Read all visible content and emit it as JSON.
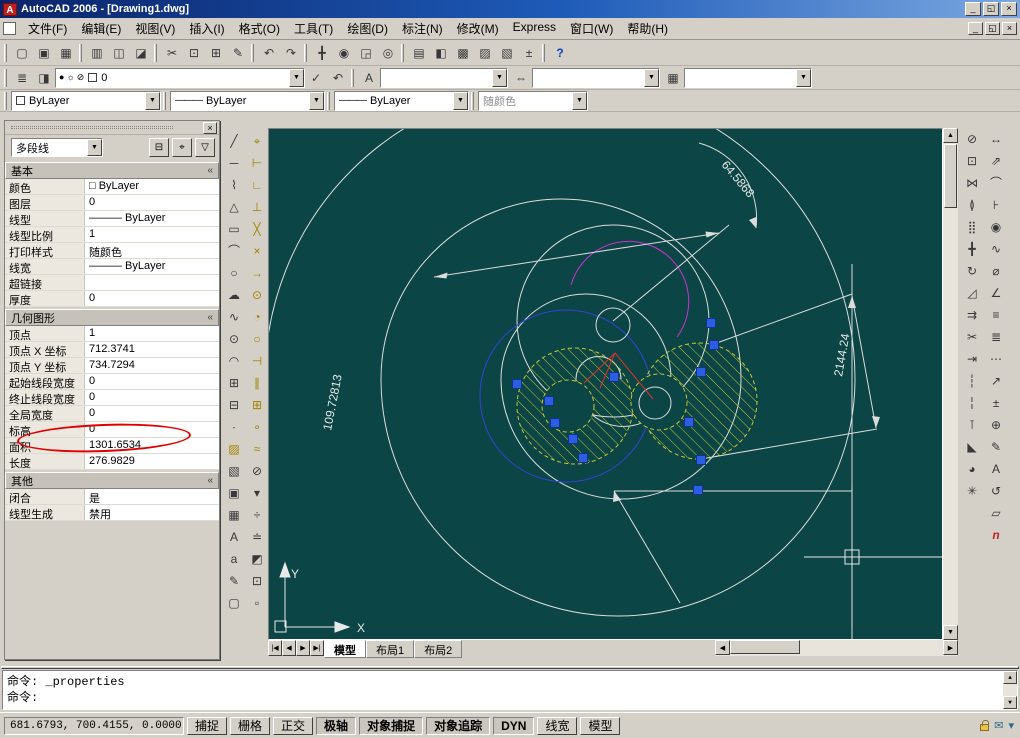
{
  "window": {
    "title": "AutoCAD 2006 - [Drawing1.dwg]",
    "app_icon": "A",
    "controls": [
      {
        "name": "minimize-button",
        "glyph": "_"
      },
      {
        "name": "restore-button",
        "glyph": "◱"
      },
      {
        "name": "close-button",
        "glyph": "×"
      }
    ]
  },
  "menu": {
    "items": [
      "文件(F)",
      "编辑(E)",
      "视图(V)",
      "插入(I)",
      "格式(O)",
      "工具(T)",
      "绘图(D)",
      "标注(N)",
      "修改(M)",
      "Express",
      "窗口(W)",
      "帮助(H)"
    ]
  },
  "scroll": {
    "up": "▲",
    "down": "▼",
    "left": "◀",
    "right": "▶"
  },
  "toolbar_main": {
    "file": [
      {
        "name": "new-file-icon",
        "glyph": "▢"
      },
      {
        "name": "open-file-icon",
        "glyph": "▣"
      },
      {
        "name": "save-icon",
        "glyph": "▦"
      }
    ],
    "print": [
      {
        "name": "plot-icon",
        "glyph": "▥"
      },
      {
        "name": "plot-preview-icon",
        "glyph": "◫"
      },
      {
        "name": "publish-icon",
        "glyph": "◪"
      }
    ],
    "clip": [
      {
        "name": "cut-icon",
        "glyph": "✂"
      },
      {
        "name": "copy-icon",
        "glyph": "⊡"
      },
      {
        "name": "paste-icon",
        "glyph": "⊞"
      },
      {
        "name": "match-properties-icon",
        "glyph": "✎"
      }
    ],
    "undo": [
      {
        "name": "undo-icon",
        "glyph": "↶"
      },
      {
        "name": "redo-icon",
        "glyph": "↷"
      }
    ],
    "zoom": [
      {
        "name": "pan-icon",
        "glyph": "╋"
      },
      {
        "name": "zoom-realtime-icon",
        "glyph": "◉"
      },
      {
        "name": "zoom-window-icon",
        "glyph": "◲"
      },
      {
        "name": "zoom-previous-icon",
        "glyph": "◎"
      }
    ],
    "palettes": [
      {
        "name": "properties-palette-icon",
        "glyph": "▤"
      },
      {
        "name": "designcenter-icon",
        "glyph": "◧"
      },
      {
        "name": "tool-palettes-icon",
        "glyph": "▩"
      },
      {
        "name": "sheet-set-manager-icon",
        "glyph": "▨"
      },
      {
        "name": "markup-set-manager-icon",
        "glyph": "▧"
      },
      {
        "name": "quickcalc-icon",
        "glyph": "±"
      }
    ],
    "help": [
      {
        "name": "help-icon",
        "glyph": "?",
        "cls": "blue"
      }
    ]
  },
  "layers_toolbar": {
    "icons_left": [
      {
        "name": "layer-properties-manager-icon",
        "glyph": "≣"
      },
      {
        "name": "layer-states-icon",
        "glyph": "◨"
      }
    ],
    "layer_dropdown": {
      "status_icons": [
        "●",
        "☼",
        "⊘"
      ],
      "value": "0"
    },
    "icons_right": [
      {
        "name": "make-object-layer-current-icon",
        "glyph": "✓"
      },
      {
        "name": "layer-previous-icon",
        "glyph": "↶"
      }
    ],
    "styles": [
      {
        "name": "text-style-control",
        "icon": "A",
        "value": ""
      },
      {
        "name": "dim-style-control",
        "icon": "⇔",
        "value": ""
      },
      {
        "name": "table-style-control",
        "icon": "▦",
        "value": ""
      }
    ]
  },
  "properties_toolbar": {
    "line_sample": "———",
    "color_value": "ByLayer",
    "linetype_value": "ByLayer",
    "lineweight_value": "ByLayer",
    "plotstyle_value": "随颜色"
  },
  "left_toolbars": {
    "draw": [
      {
        "name": "line-icon",
        "glyph": "╱"
      },
      {
        "name": "construction-line-icon",
        "glyph": "─"
      },
      {
        "name": "polyline-icon",
        "glyph": "⌇"
      },
      {
        "name": "polygon-icon",
        "glyph": "△"
      },
      {
        "name": "rectangle-icon",
        "glyph": "▭"
      },
      {
        "name": "arc-icon",
        "glyph": "⌒"
      },
      {
        "name": "circle-icon",
        "glyph": "○"
      },
      {
        "name": "revision-cloud-icon",
        "glyph": "☁"
      },
      {
        "name": "spline-icon",
        "glyph": "∿"
      },
      {
        "name": "ellipse-icon",
        "glyph": "⊙"
      },
      {
        "name": "ellipse-arc-icon",
        "glyph": "◠"
      },
      {
        "name": "insert-block-icon",
        "glyph": "⊞"
      },
      {
        "name": "make-block-icon",
        "glyph": "⊟"
      },
      {
        "name": "point-icon",
        "glyph": "∙"
      },
      {
        "name": "hatch-icon",
        "glyph": "▨",
        "cls": "yellow"
      },
      {
        "name": "gradient-icon",
        "glyph": "▧"
      },
      {
        "name": "region-icon",
        "glyph": "▣"
      },
      {
        "name": "table-icon",
        "glyph": "▦"
      },
      {
        "name": "multiline-text-icon",
        "glyph": "A"
      },
      {
        "name": "single-line-text-icon",
        "glyph": "a"
      },
      {
        "name": "edit-text-icon",
        "glyph": "✎"
      },
      {
        "name": "boundary-icon",
        "glyph": "▢"
      }
    ],
    "aux": [
      {
        "name": "temporary-track-point-icon",
        "glyph": "⌖",
        "cls": "yellow"
      },
      {
        "name": "snap-from-icon",
        "glyph": "⊢",
        "cls": "yellow"
      },
      {
        "name": "snap-endpoint-icon",
        "glyph": "∟",
        "cls": "yellow"
      },
      {
        "name": "snap-midpoint-icon",
        "glyph": "⊥",
        "cls": "yellow"
      },
      {
        "name": "snap-intersection-icon",
        "glyph": "╳",
        "cls": "yellow"
      },
      {
        "name": "snap-apparent-intersection-icon",
        "glyph": "×",
        "cls": "yellow"
      },
      {
        "name": "snap-extension-icon",
        "glyph": "→",
        "cls": "yellow"
      },
      {
        "name": "snap-center-icon",
        "glyph": "⊙",
        "cls": "yellow"
      },
      {
        "name": "snap-quadrant-icon",
        "glyph": "◔",
        "cls": "yellow"
      },
      {
        "name": "snap-tangent-icon",
        "glyph": "○",
        "cls": "yellow"
      },
      {
        "name": "snap-perpendicular-icon",
        "glyph": "⊣",
        "cls": "yellow"
      },
      {
        "name": "snap-parallel-icon",
        "glyph": "∥",
        "cls": "yellow"
      },
      {
        "name": "snap-insert-icon",
        "glyph": "⊞",
        "cls": "yellow"
      },
      {
        "name": "snap-node-icon",
        "glyph": "∘",
        "cls": "yellow"
      },
      {
        "name": "snap-nearest-icon",
        "glyph": "≈",
        "cls": "yellow"
      },
      {
        "name": "snap-none-icon",
        "glyph": "⊘"
      },
      {
        "name": "osnap-settings-icon",
        "glyph": "▾"
      },
      {
        "name": "divide-icon",
        "glyph": "÷"
      },
      {
        "name": "measure-icon",
        "glyph": "≐"
      },
      {
        "name": "block-editor-icon",
        "glyph": "◩"
      },
      {
        "name": "xref-icon",
        "glyph": "⊡"
      },
      {
        "name": "image-icon",
        "glyph": "▫"
      }
    ]
  },
  "right_toolbars": {
    "modify": [
      {
        "name": "erase-icon",
        "glyph": "⊘"
      },
      {
        "name": "copy-object-icon",
        "glyph": "⊡"
      },
      {
        "name": "mirror-icon",
        "glyph": "⋈"
      },
      {
        "name": "offset-icon",
        "glyph": "≬"
      },
      {
        "name": "array-icon",
        "glyph": "⣿"
      },
      {
        "name": "move-icon",
        "glyph": "╋"
      },
      {
        "name": "rotate-icon",
        "glyph": "↻"
      },
      {
        "name": "scale-icon",
        "glyph": "◿"
      },
      {
        "name": "stretch-icon",
        "glyph": "⇉"
      },
      {
        "name": "trim-icon",
        "glyph": "✂"
      },
      {
        "name": "extend-icon",
        "glyph": "⇥"
      },
      {
        "name": "break-at-point-icon",
        "glyph": "┆"
      },
      {
        "name": "break-icon",
        "glyph": "╎"
      },
      {
        "name": "join-icon",
        "glyph": "⊺"
      },
      {
        "name": "chamfer-icon",
        "glyph": "◣"
      },
      {
        "name": "fillet-icon",
        "glyph": "◕"
      },
      {
        "name": "explode-icon",
        "glyph": "✳"
      }
    ],
    "dimension": [
      {
        "name": "linear-dimension-icon",
        "glyph": "↔"
      },
      {
        "name": "aligned-dimension-icon",
        "glyph": "⇗"
      },
      {
        "name": "arc-length-dimension-icon",
        "glyph": "⌒"
      },
      {
        "name": "ordinate-dimension-icon",
        "glyph": "⊦"
      },
      {
        "name": "radius-dimension-icon",
        "glyph": "◉"
      },
      {
        "name": "jogged-dimension-icon",
        "glyph": "∿"
      },
      {
        "name": "diameter-dimension-icon",
        "glyph": "⌀"
      },
      {
        "name": "angular-dimension-icon",
        "glyph": "∠"
      },
      {
        "name": "quick-dimension-icon",
        "glyph": "≡"
      },
      {
        "name": "baseline-dimension-icon",
        "glyph": "≣"
      },
      {
        "name": "continue-dimension-icon",
        "glyph": "⋯"
      },
      {
        "name": "quick-leader-icon",
        "glyph": "↗"
      },
      {
        "name": "tolerance-icon",
        "glyph": "±"
      },
      {
        "name": "center-mark-icon",
        "glyph": "⊕"
      },
      {
        "name": "dimension-edit-icon",
        "glyph": "✎"
      },
      {
        "name": "dimension-text-edit-icon",
        "glyph": "A"
      },
      {
        "name": "dimension-update-icon",
        "glyph": "↺"
      },
      {
        "name": "dimension-style-icon",
        "glyph": "▱"
      },
      {
        "name": "ole-object-icon",
        "glyph": "n",
        "cls": "red"
      }
    ]
  },
  "properties_panel": {
    "close_glyph": "×",
    "chevron": "«",
    "selector": {
      "value": "多段线",
      "buttons": [
        {
          "name": "toggle-pickadd-button",
          "glyph": "⊟"
        },
        {
          "name": "select-objects-button",
          "glyph": "⌖"
        },
        {
          "name": "quick-select-button",
          "glyph": "▽"
        }
      ]
    },
    "sections": {
      "basic": {
        "title": "基本",
        "rows": [
          [
            "颜色",
            "□ ByLayer"
          ],
          [
            "图层",
            "0"
          ],
          [
            "线型",
            "——— ByLayer"
          ],
          [
            "线型比例",
            "1"
          ],
          [
            "打印样式",
            "随颜色"
          ],
          [
            "线宽",
            "——— ByLayer"
          ],
          [
            "超链接",
            ""
          ],
          [
            "厚度",
            "0"
          ]
        ]
      },
      "geometry": {
        "title": "几何图形",
        "rows": [
          [
            "顶点",
            "1"
          ],
          [
            "顶点 X 坐标",
            "712.3741"
          ],
          [
            "顶点 Y 坐标",
            "734.7294"
          ],
          [
            "起始线段宽度",
            "0"
          ],
          [
            "终止线段宽度",
            "0"
          ],
          [
            "全局宽度",
            "0"
          ],
          [
            "标高",
            "0"
          ],
          [
            "面积",
            "1301.6534"
          ],
          [
            "长度",
            "276.9829"
          ]
        ]
      },
      "other": {
        "title": "其他",
        "rows": [
          [
            "闭合",
            "是"
          ],
          [
            "线型生成",
            "禁用"
          ]
        ]
      }
    }
  },
  "canvas": {
    "dimensions": {
      "arc": "64.5868",
      "radius": "109.72813",
      "linear": "2144.24"
    },
    "axis": {
      "x": "X",
      "y": "Y"
    }
  },
  "tabs": {
    "nav": [
      "|◀",
      "◀",
      "▶",
      "▶|"
    ],
    "items": [
      "模型",
      "布局1",
      "布局2"
    ]
  },
  "command": {
    "lines": [
      "命令: _properties",
      "命令:"
    ]
  },
  "status": {
    "coords": "681.6793, 700.4155, 0.0000",
    "toggles": [
      {
        "name": "toggle-snap",
        "label": "捕捉",
        "on": false
      },
      {
        "name": "toggle-grid",
        "label": "栅格",
        "on": false
      },
      {
        "name": "toggle-ortho",
        "label": "正交",
        "on": false
      },
      {
        "name": "toggle-polar",
        "label": "极轴",
        "on": true
      },
      {
        "name": "toggle-osnap",
        "label": "对象捕捉",
        "on": true
      },
      {
        "name": "toggle-otrack",
        "label": "对象追踪",
        "on": true
      },
      {
        "name": "toggle-dyn",
        "label": "DYN",
        "on": true
      },
      {
        "name": "toggle-lwt",
        "label": "线宽",
        "on": false
      },
      {
        "name": "toggle-model",
        "label": "模型",
        "on": false
      }
    ],
    "tray_comm_glyph": "✉",
    "tray_menu_glyph": "▾"
  }
}
